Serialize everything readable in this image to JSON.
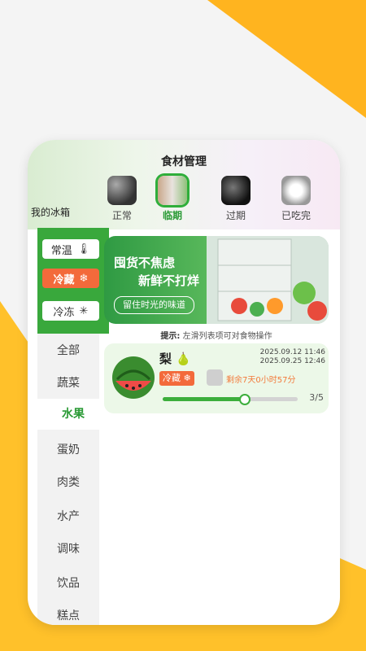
{
  "header": {
    "title": "食材管理",
    "fridge_label": "我的冰箱"
  },
  "status_tabs": [
    {
      "label": "正常",
      "active": false
    },
    {
      "label": "临期",
      "active": true
    },
    {
      "label": "过期",
      "active": false
    },
    {
      "label": "已吃完",
      "active": false
    }
  ],
  "temperature_modes": [
    {
      "label": "常温",
      "icon": "thermometer-icon",
      "active": false
    },
    {
      "label": "冷藏",
      "icon": "fridge-cold-icon",
      "active": true
    },
    {
      "label": "冷冻",
      "icon": "snowflake-icon",
      "active": false
    }
  ],
  "categories": [
    {
      "label": "全部",
      "active": false
    },
    {
      "label": "蔬菜",
      "active": false
    },
    {
      "label": "水果",
      "active": true
    },
    {
      "label": "蛋奶",
      "active": false
    },
    {
      "label": "肉类",
      "active": false
    },
    {
      "label": "水产",
      "active": false
    },
    {
      "label": "调味",
      "active": false
    },
    {
      "label": "饮品",
      "active": false
    },
    {
      "label": "糕点",
      "active": false
    }
  ],
  "banner": {
    "line1": "囤货不焦虑",
    "line2": "新鲜不打烊",
    "pill": "留住时光的味道"
  },
  "tip": {
    "prefix": "提示:",
    "text": "左滑列表项可对食物操作"
  },
  "item": {
    "name": "梨",
    "date1": "2025.09.12 11:46",
    "date2": "2025.09.25 12:46",
    "storage_tag": "冷藏",
    "remaining": "剩余7天0小时57分",
    "progress_text": "3/5",
    "progress_fraction": 0.6
  },
  "colors": {
    "green": "#2fae3a",
    "orange": "#f36a3b",
    "yellow": "#ffc12a"
  }
}
